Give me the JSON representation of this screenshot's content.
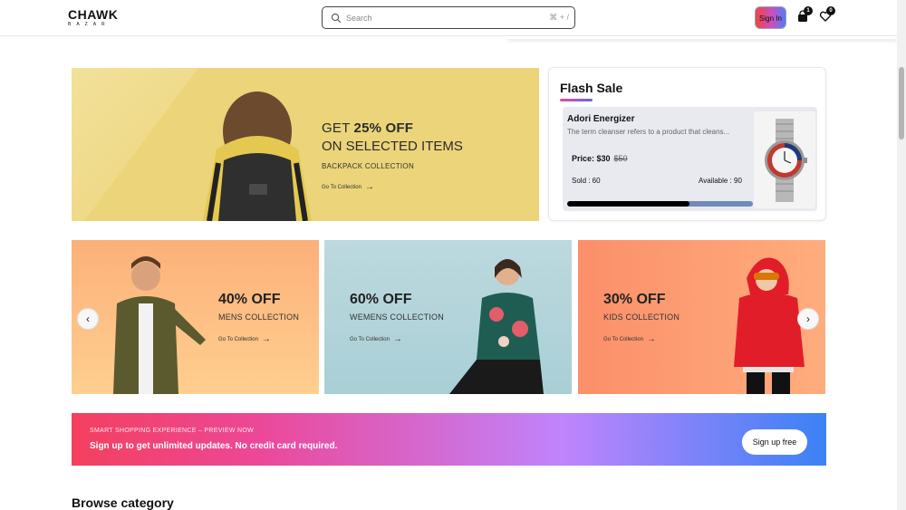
{
  "header": {
    "logo_main": "CHAWK",
    "logo_sub": "BAZAR",
    "search_placeholder": "Search",
    "search_shortcut": "⌘ + /",
    "signin_label": "Sign In",
    "cart_count": "1",
    "wishlist_count": "0"
  },
  "hero": {
    "line1_prefix": "GET ",
    "line1_bold": "25% OFF",
    "line2": "ON SELECTED ITEMS",
    "subtitle": "BACKPACK COLLECTION",
    "link": "Go To Collection",
    "arrow": "→"
  },
  "flash_sale": {
    "title": "Flash Sale",
    "product_name": "Adori Energizer",
    "product_desc": "The term cleanser refers to a product that cleans...",
    "price": "Price: $30",
    "old_price": "$50",
    "sold": "Sold : 60",
    "available": "Available : 90",
    "progress_fraction": 0.66
  },
  "collections": [
    {
      "discount": "40% OFF",
      "name": "MENS COLLECTION",
      "link": "Go To Collection",
      "arrow": "→"
    },
    {
      "discount": "60% OFF",
      "name": "WEMENS COLLECTION",
      "link": "Go To Collection",
      "arrow": "→"
    },
    {
      "discount": "30% OFF",
      "name": "KIDS COLLECTION",
      "link": "Go To Collection",
      "arrow": "→"
    }
  ],
  "carousel": {
    "prev": "‹",
    "next": "›"
  },
  "signup": {
    "small": "SMART SHOPPING EXPERIENCE – PREVIEW NOW",
    "main": "Sign up to get unlimited updates. No credit card required.",
    "button": "Sign up free"
  },
  "browse_title": "Browse category",
  "colors": {
    "hero_bg": "#ebd47a",
    "accent_gradient_start": "#f43f5e",
    "accent_gradient_end": "#3b82f6"
  }
}
